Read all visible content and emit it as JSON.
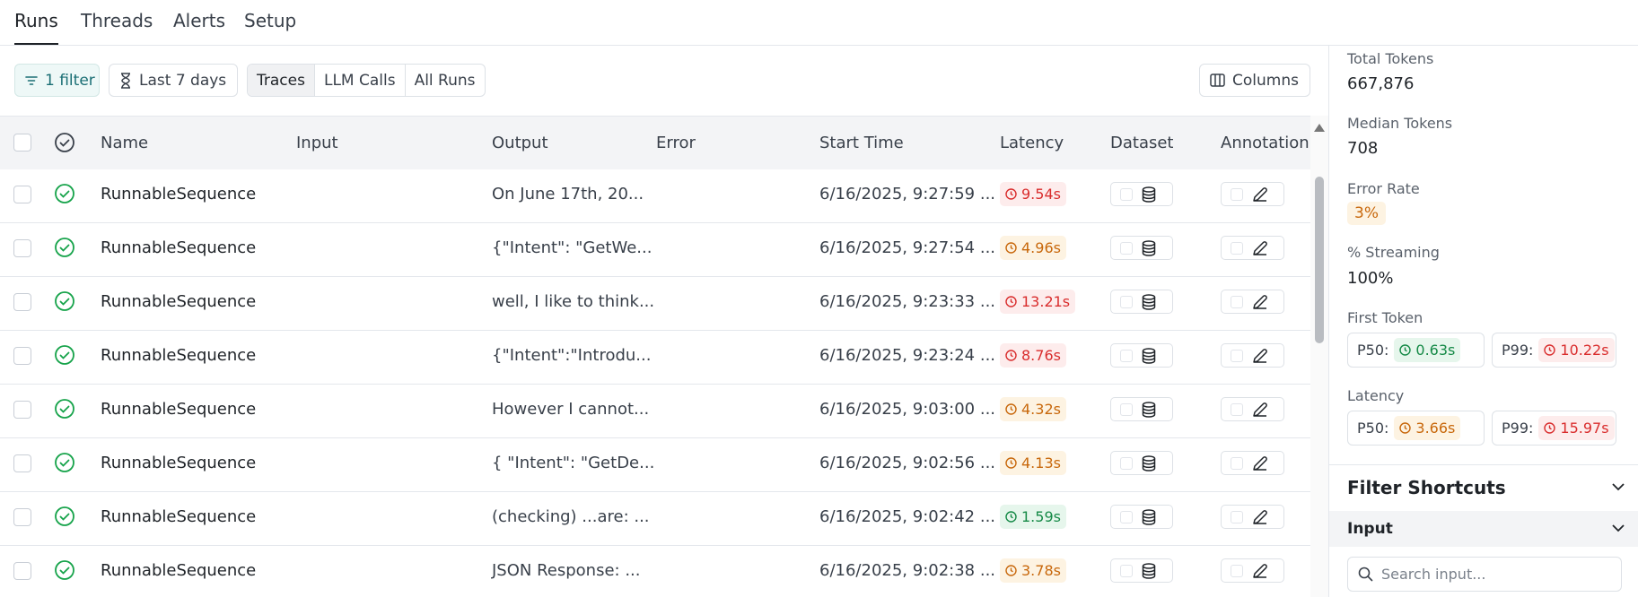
{
  "tabs": [
    {
      "label": "Runs",
      "active": true
    },
    {
      "label": "Threads",
      "active": false
    },
    {
      "label": "Alerts",
      "active": false
    },
    {
      "label": "Setup",
      "active": false
    }
  ],
  "toolbar": {
    "filter_label": "1 filter",
    "date_label": "Last 7 days",
    "segments": [
      "Traces",
      "LLM Calls",
      "All Runs"
    ],
    "selected_segment": "Traces",
    "columns_label": "Columns"
  },
  "table": {
    "headers": {
      "name": "Name",
      "input": "Input",
      "output": "Output",
      "error": "Error",
      "start_time": "Start Time",
      "latency": "Latency",
      "dataset": "Dataset",
      "annotation": "Annotation"
    },
    "rows": [
      {
        "name": "RunnableSequence",
        "output": "On June 17th, 20...",
        "start_time": "6/16/2025, 9:27:59 ...",
        "latency": "9.54s",
        "latency_status": "red"
      },
      {
        "name": "RunnableSequence",
        "output": "{\"Intent\": \"GetWe...",
        "start_time": "6/16/2025, 9:27:54 ...",
        "latency": "4.96s",
        "latency_status": "amber"
      },
      {
        "name": "RunnableSequence",
        "output": "well, I like to think...",
        "start_time": "6/16/2025, 9:23:33 ...",
        "latency": "13.21s",
        "latency_status": "red"
      },
      {
        "name": "RunnableSequence",
        "output": "{\"Intent\":\"Introdu...",
        "start_time": "6/16/2025, 9:23:24 ...",
        "latency": "8.76s",
        "latency_status": "red"
      },
      {
        "name": "RunnableSequence",
        "output": "However I cannot...",
        "start_time": "6/16/2025, 9:03:00 ...",
        "latency": "4.32s",
        "latency_status": "amber"
      },
      {
        "name": "RunnableSequence",
        "output": "{ \"Intent\": \"GetDe...",
        "start_time": "6/16/2025, 9:02:56 ...",
        "latency": "4.13s",
        "latency_status": "amber"
      },
      {
        "name": "RunnableSequence",
        "output": "(checking) ...are: ...",
        "start_time": "6/16/2025, 9:02:42 ...",
        "latency": "1.59s",
        "latency_status": "green"
      },
      {
        "name": "RunnableSequence",
        "output": "JSON Response: ...",
        "start_time": "6/16/2025, 9:02:38 ...",
        "latency": "3.78s",
        "latency_status": "amber"
      }
    ]
  },
  "stats": {
    "total_tokens_label": "Total Tokens",
    "total_tokens": "667,876",
    "median_tokens_label": "Median Tokens",
    "median_tokens": "708",
    "error_rate_label": "Error Rate",
    "error_rate": "3%",
    "streaming_label": "% Streaming",
    "streaming": "100%",
    "first_token_label": "First Token",
    "first_token_p50_label": "P50:",
    "first_token_p50": "0.63s",
    "first_token_p99_label": "P99:",
    "first_token_p99": "10.22s",
    "latency_label": "Latency",
    "latency_p50_label": "P50:",
    "latency_p50": "3.66s",
    "latency_p99_label": "P99:",
    "latency_p99": "15.97s"
  },
  "filter_shortcuts": {
    "title": "Filter Shortcuts",
    "input_section": "Input",
    "search_placeholder": "Search input..."
  },
  "colors": {
    "accent": "#1a6e74",
    "success": "#16a34a",
    "error": "#d92d2d",
    "warning": "#c8680c"
  }
}
